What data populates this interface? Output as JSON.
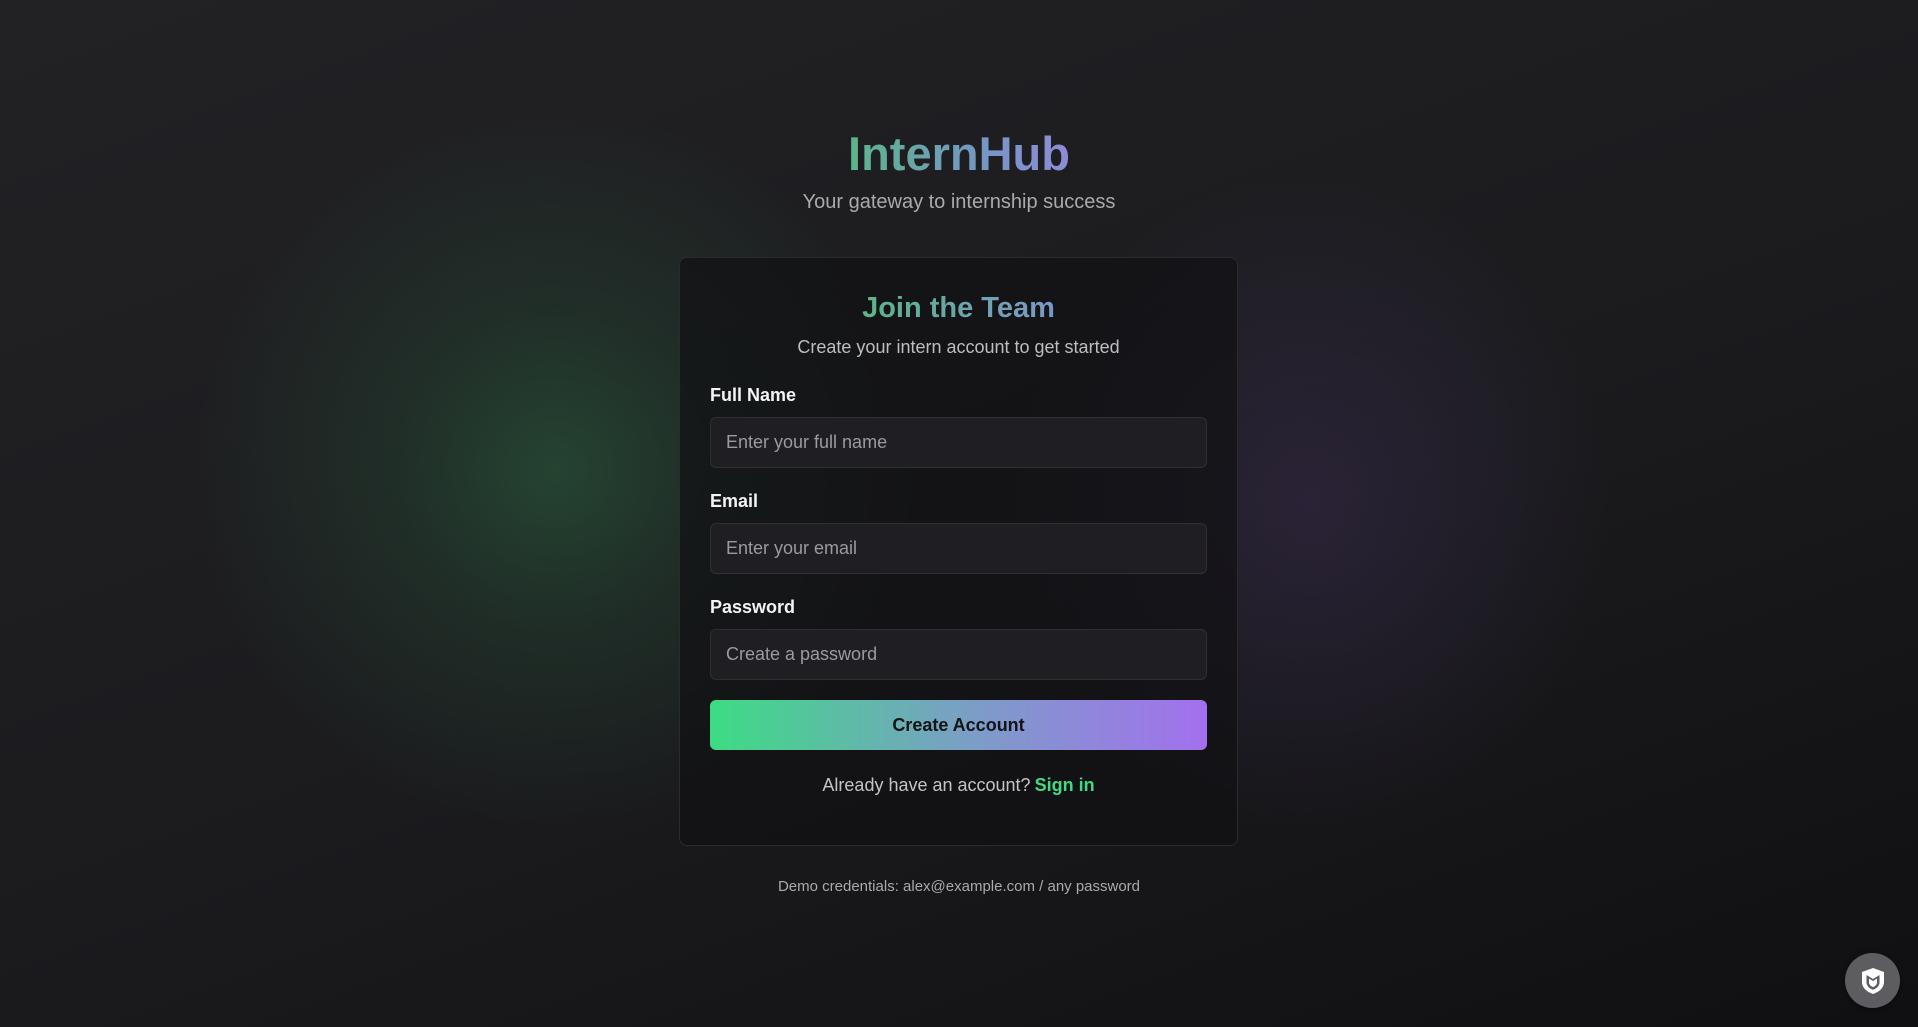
{
  "brand": {
    "name": "InternHub",
    "tagline": "Your gateway to internship success"
  },
  "card": {
    "title": "Join the Team",
    "subtitle": "Create your intern account to get started",
    "fields": {
      "full_name": {
        "label": "Full Name",
        "placeholder": "Enter your full name",
        "value": ""
      },
      "email": {
        "label": "Email",
        "placeholder": "Enter your email",
        "value": ""
      },
      "password": {
        "label": "Password",
        "placeholder": "Create a password",
        "value": ""
      }
    },
    "submit_label": "Create Account",
    "signin_prompt": "Already have an account?",
    "signin_link": "Sign in"
  },
  "demo_note": "Demo credentials: alex@example.com / any password",
  "widget": {
    "icon": "shield-logo-icon"
  },
  "colors": {
    "accent_green": "#3ddc84",
    "accent_purple": "#a370ee",
    "background": "#1c1c1f"
  }
}
